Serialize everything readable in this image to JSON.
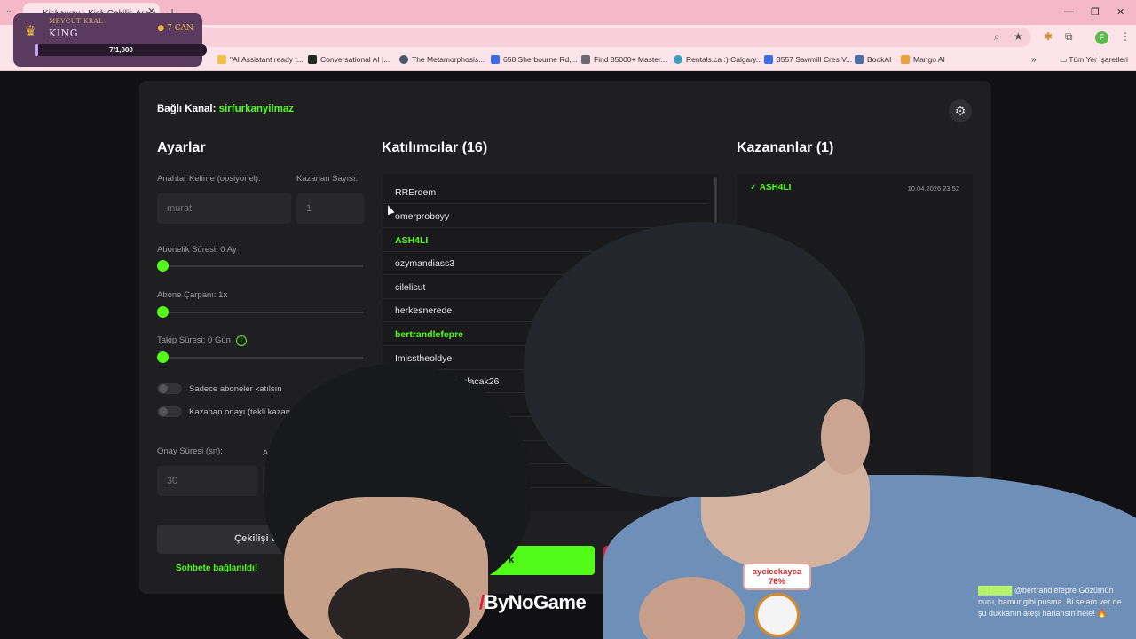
{
  "browser": {
    "tab_title": "Kickaway - Kick Çekiliş Aracı",
    "bookmarks": [
      "\"AI Assistant ready t...",
      "Conversational AI |...",
      "The Metamorphosis...",
      "658 Sherbourne Rd,...",
      "Find 85000+ Master...",
      "Rentals.ca :) Calgary...",
      "3557 Sawmill Cres V...",
      "BookAI",
      "Mango AI"
    ],
    "all_bookmarks_label": "Tüm Yer İşaretleri",
    "profile_initial": "F"
  },
  "overlay_king": {
    "label": "MEVCUT KRAL",
    "name": "KİNG",
    "lives": "7 CAN",
    "progress_text": "7/1,000",
    "progress_fraction": 0.007
  },
  "app": {
    "channel_label": "Bağlı Kanal:",
    "channel_name": "sirfurkanyilmaz",
    "settings": {
      "title": "Ayarlar",
      "keyword_label": "Anahtar Kelime (opsiyonel):",
      "keyword_value": "murat",
      "winners_count_label": "Kazanan Sayısı:",
      "winners_count_value": "1",
      "sub_duration_label": "Abonelik Süresi: 0 Ay",
      "sub_multiplier_label": "Abone Çarpanı: 1x",
      "follow_duration_label": "Takip Süresi:  0  Gün",
      "subs_only_label": "Sadece aboneler katılsın",
      "winner_confirm_label": "Kazanan onayı (tekli kazanand",
      "confirm_time_label": "Onay Süresi (sn):",
      "confirm_time_value": "30",
      "animation_label": "Anim",
      "start_button": "Çekilişi Ba",
      "status": "Sohbete bağlanıldı!"
    },
    "participants": {
      "title": "Katılımcılar (16)",
      "items": [
        {
          "name": "RRErdem",
          "highlight": false
        },
        {
          "name": "omerproboyy",
          "highlight": false
        },
        {
          "name": "ASH4LI",
          "highlight": true
        },
        {
          "name": "ozymandiass3",
          "highlight": false
        },
        {
          "name": "cilelisut",
          "highlight": false
        },
        {
          "name": "herkesnerede",
          "highlight": false
        },
        {
          "name": "bertrandlefepre",
          "highlight": true
        },
        {
          "name": "Imisstheoldye",
          "highlight": false
        },
        {
          "name": "yguzelolacak26",
          "highlight": false
        }
      ],
      "green_button": "k"
    },
    "winners": {
      "title": "Kazananlar (1)",
      "items": [
        {
          "name": "✓ ASH4LI",
          "time": "10.04.2026 23:52"
        }
      ]
    }
  },
  "stream": {
    "brand": "ByNoGame",
    "vote_user": "aycicekayca",
    "vote_percent": "76%",
    "chat_message": "@bertrandlefepre Gözümün nuru, hamur gibi pusma. Bi selam ver de şu dukkanın ateşi harlansın hele! 🔥"
  },
  "colors": {
    "kick_green": "#53fc18",
    "card_bg": "#1f1f22",
    "tab_pink": "#f4b8c8",
    "danger_red": "#e8163a"
  }
}
